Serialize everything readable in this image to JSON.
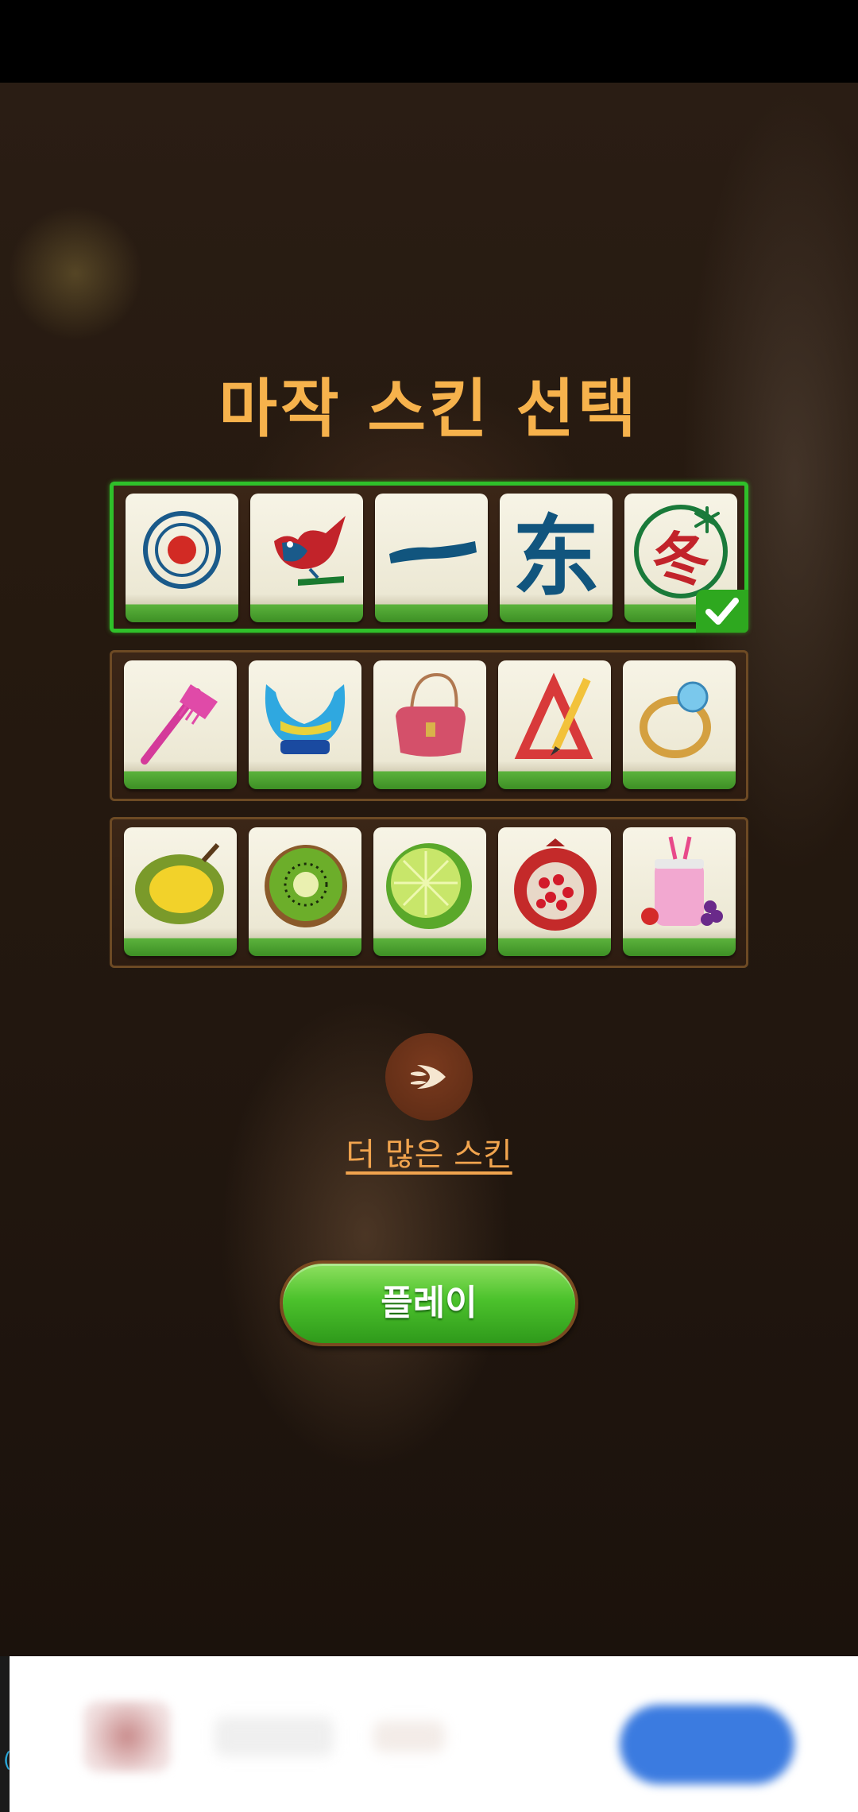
{
  "title": "마작 스킨 선택",
  "skins": [
    {
      "name": "classic-mahjong",
      "selected": true,
      "tiles": [
        "circle-dot-icon",
        "bird-bamboo-icon",
        "character-one-icon",
        "east-wind-icon",
        "winter-flower-icon"
      ]
    },
    {
      "name": "items",
      "selected": false,
      "tiles": [
        "comb-icon",
        "bra-icon",
        "handbag-icon",
        "ruler-pencil-icon",
        "ring-icon"
      ]
    },
    {
      "name": "fruits",
      "selected": false,
      "tiles": [
        "durian-icon",
        "kiwi-icon",
        "lime-icon",
        "pomegranate-icon",
        "smoothie-icon"
      ]
    }
  ],
  "more_skins_label": "더 많은 스킨",
  "play_label": "플레이",
  "colors": {
    "title": "#f6b24c",
    "selected_border": "#2fc02a",
    "play_button": "#4cc22c",
    "link": "#f1a44e"
  }
}
